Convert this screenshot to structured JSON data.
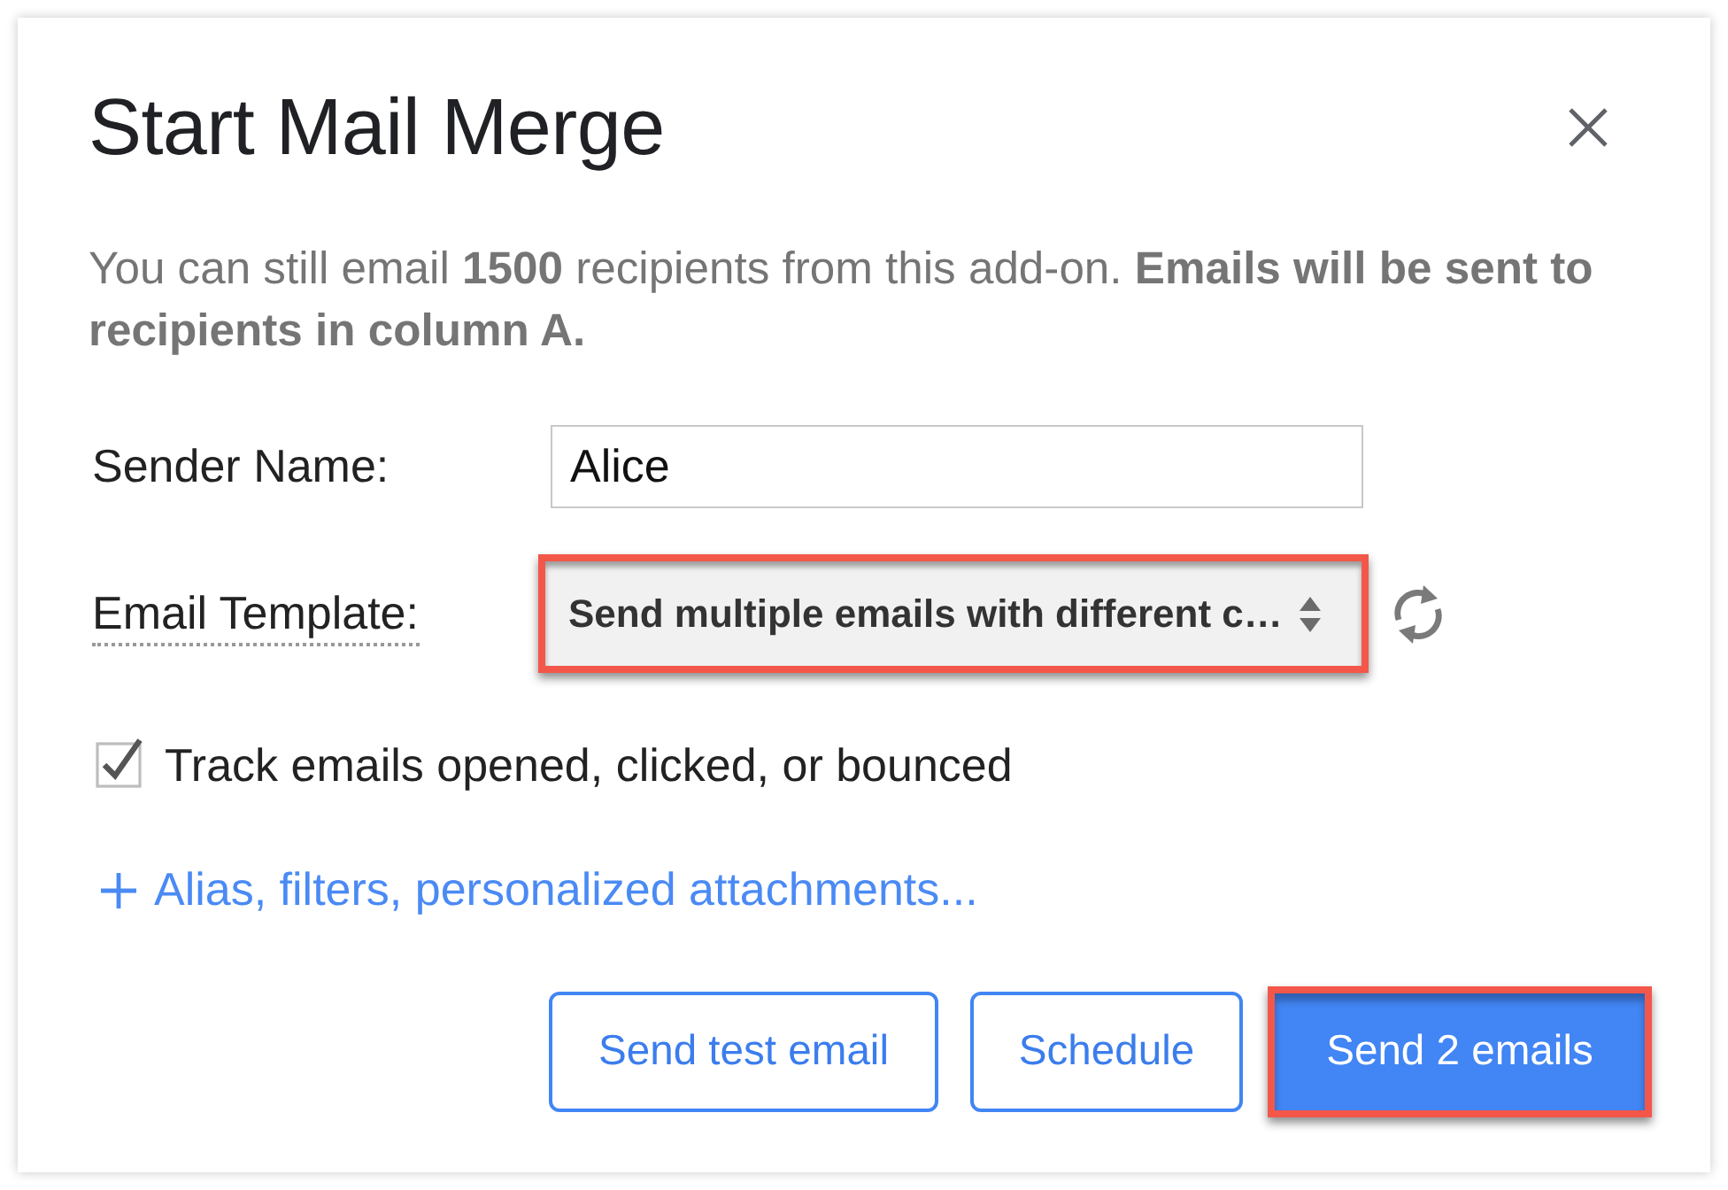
{
  "dialog": {
    "title": "Start Mail Merge"
  },
  "notice": "You can still email **1500** recipients from this add-on. **Emails will be sent to recipients in column A.**",
  "sender_name": {
    "label": "Sender Name:",
    "value": "Alice"
  },
  "email_template": {
    "label": "Email Template:",
    "value": "Send multiple emails with different c…",
    "highlighted": true
  },
  "track_option": {
    "label": "Track emails opened, clicked, or bounced",
    "checked": true
  },
  "more_options_link": "Alias, filters, personalized attachments...",
  "buttons": [
    {
      "label": "Send test email",
      "kind": "outlined",
      "highlighted": false
    },
    {
      "label": "Schedule",
      "kind": "outlined",
      "highlighted": false
    },
    {
      "label": "Send 2 emails",
      "kind": "primary",
      "highlighted": true
    }
  ]
}
